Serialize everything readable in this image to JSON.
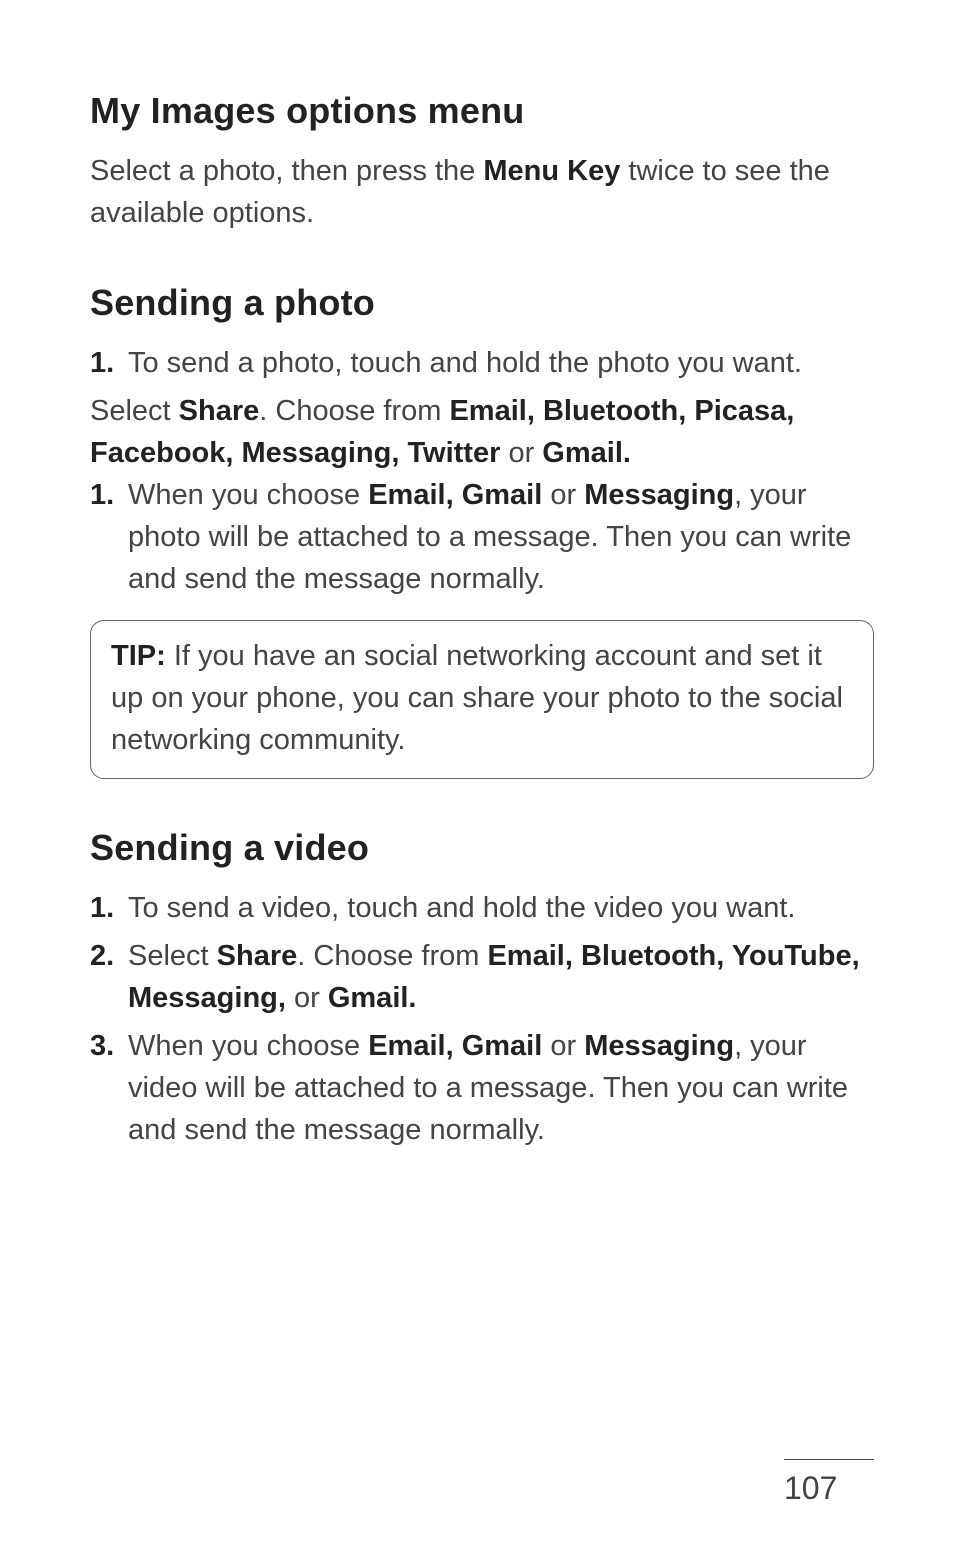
{
  "sections": {
    "myImages": {
      "heading": "My Images options menu",
      "para_pre": "Select a photo, then press the ",
      "para_bold": "Menu Key",
      "para_post": " twice to see the available options."
    },
    "sendingPhoto": {
      "heading": "Sending a photo",
      "step1_num": "1.",
      "step1_text": "To send a photo, touch and hold the photo you want.",
      "share_line": {
        "t0": "Select ",
        "b0": "Share",
        "t1": ". Choose from ",
        "b1": "Email, Bluetooth, Picasa, Facebook, Messaging, Twitter",
        "t2": " or ",
        "b2": "Gmail."
      },
      "step1b_num": "1.",
      "step1b": {
        "t0": "When you choose ",
        "b0": "Email, Gmail",
        "t1": " or ",
        "b1": "Messaging",
        "t2": ", your photo will be attached to a message. Then you can write and send the message normally."
      },
      "tip": {
        "label": "TIP:",
        "text": " If you have an social networking account and set it up on your phone, you can share your photo to the social networking community."
      }
    },
    "sendingVideo": {
      "heading": "Sending a video",
      "step1_num": "1.",
      "step1_text": "To send a video, touch and hold the video you want.",
      "step2_num": "2.",
      "step2": {
        "t0": "Select ",
        "b0": "Share",
        "t1": ". Choose from ",
        "b1": "Email, Bluetooth, YouTube, Messaging,",
        "t2": " or ",
        "b2": "Gmail."
      },
      "step3_num": "3.",
      "step3": {
        "t0": "When you choose ",
        "b0": "Email, Gmail",
        "t1": " or ",
        "b1": "Messaging",
        "t2": ", your video will be attached to a message. Then you can write and send the message normally."
      }
    }
  },
  "pageNumber": "107"
}
